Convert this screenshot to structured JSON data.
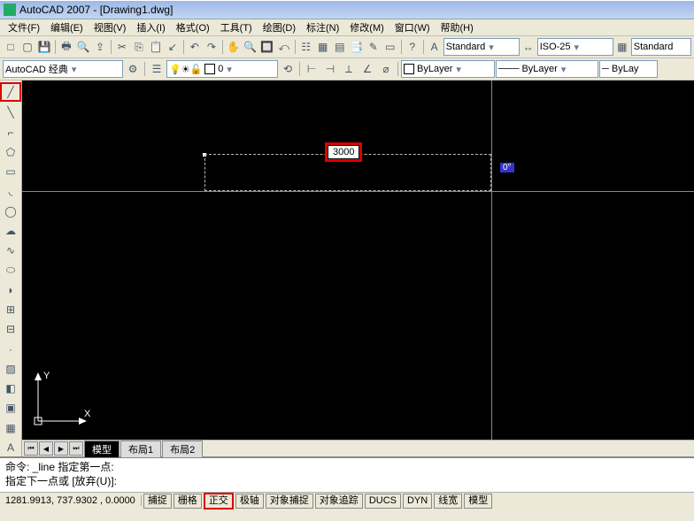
{
  "title": "AutoCAD 2007 - [Drawing1.dwg]",
  "menus": [
    "文件(F)",
    "编辑(E)",
    "视图(V)",
    "插入(I)",
    "格式(O)",
    "工具(T)",
    "绘图(D)",
    "标注(N)",
    "修改(M)",
    "窗口(W)",
    "帮助(H)"
  ],
  "workspace": "AutoCAD 经典",
  "styles": {
    "text_style": "Standard",
    "dim_style": "ISO-25",
    "table_style": "Standard"
  },
  "layer": {
    "current": "0",
    "color": "ByLayer",
    "linetype": "ByLayer",
    "lineweight": "ByLay"
  },
  "side_tools": [
    "line",
    "cline",
    "rect",
    "poly",
    "arc",
    "circle",
    "revcloud",
    "spline",
    "ellipse",
    "earc",
    "block",
    "point",
    "hatch",
    "grad",
    "region",
    "table",
    "mtext"
  ],
  "dynamic": {
    "length": "3000",
    "angle": "0°"
  },
  "tabs": {
    "active": "模型",
    "others": [
      "布局1",
      "布局2"
    ]
  },
  "cmd": {
    "line1": "命令: _line 指定第一点:",
    "line2": "指定下一点或 [放弃(U)]:"
  },
  "status": {
    "coords": "1281.9913, 737.9302 , 0.0000",
    "buttons": [
      "捕捉",
      "栅格",
      "正交",
      "极轴",
      "对象捕捉",
      "对象追踪",
      "DUCS",
      "DYN",
      "线宽",
      "模型"
    ]
  }
}
